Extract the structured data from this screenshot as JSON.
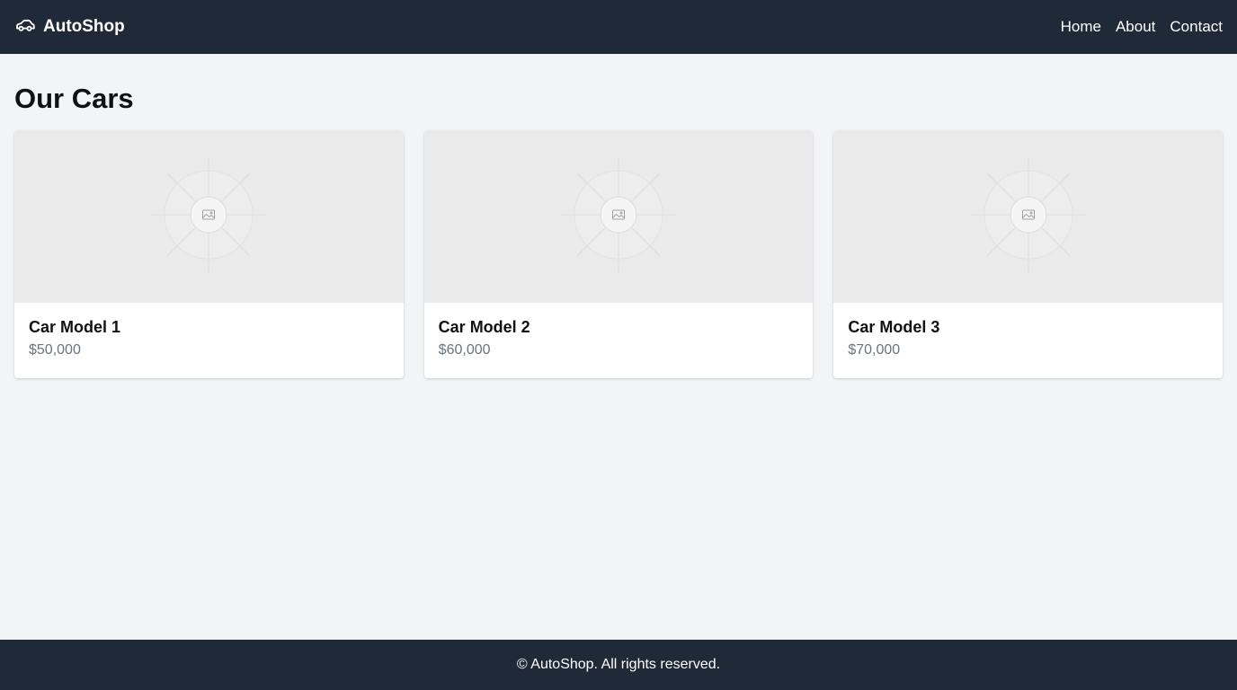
{
  "header": {
    "brand_name": "AutoShop",
    "brand_icon": "car-icon",
    "nav": [
      {
        "label": "Home"
      },
      {
        "label": "About"
      },
      {
        "label": "Contact"
      }
    ]
  },
  "main": {
    "title": "Our Cars",
    "cars": [
      {
        "name": "Car Model 1",
        "price": "$50,000",
        "image_icon": "image-placeholder-icon"
      },
      {
        "name": "Car Model 2",
        "price": "$60,000",
        "image_icon": "image-placeholder-icon"
      },
      {
        "name": "Car Model 3",
        "price": "$70,000",
        "image_icon": "image-placeholder-icon"
      }
    ]
  },
  "footer": {
    "text": "© AutoShop. All rights reserved."
  },
  "colors": {
    "header_bg": "#1f2937",
    "page_bg": "#f3f4f6",
    "card_bg": "#ffffff",
    "price_text": "#6b7280"
  }
}
